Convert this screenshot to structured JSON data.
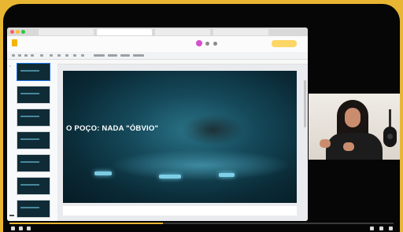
{
  "window": {
    "tabs": [
      "",
      "",
      "",
      ""
    ],
    "doc_title": "",
    "menus": [
      "",
      "",
      "",
      "",
      "",
      "",
      "",
      ""
    ],
    "slideshow_label": ""
  },
  "slide": {
    "title": "O POÇO: NADA \"ÓBVIO\"",
    "subtitle_1": "",
    "subtitle_2": "",
    "footer": ""
  },
  "filmstrip": {
    "count": 9,
    "active_index": 0
  },
  "presenter": {
    "name_tag": ""
  },
  "colors": {
    "border": "#e8b632",
    "slide_bg": "#0a2a36",
    "glow": "#8fe6ff",
    "slideshow_button": "#fcd667"
  }
}
